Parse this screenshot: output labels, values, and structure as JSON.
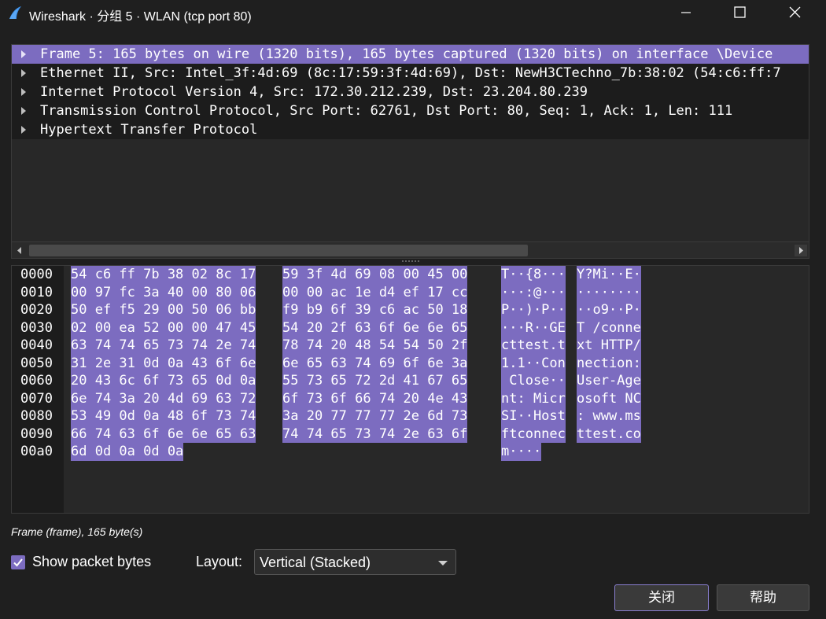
{
  "window": {
    "title": "Wireshark · 分组 5 · WLAN (tcp port 80)"
  },
  "details": {
    "rows": [
      {
        "label": "Frame 5: 165 bytes on wire (1320 bits), 165 bytes captured (1320 bits) on interface \\Device",
        "selected": true
      },
      {
        "label": "Ethernet II, Src: Intel_3f:4d:69 (8c:17:59:3f:4d:69), Dst: NewH3CTechno_7b:38:02 (54:c6:ff:7",
        "selected": false
      },
      {
        "label": "Internet Protocol Version 4, Src: 172.30.212.239, Dst: 23.204.80.239",
        "selected": false
      },
      {
        "label": "Transmission Control Protocol, Src Port: 62761, Dst Port: 80, Seq: 1, Ack: 1, Len: 111",
        "selected": false
      },
      {
        "label": "Hypertext Transfer Protocol",
        "selected": false
      }
    ]
  },
  "bytes": {
    "lines": [
      {
        "offset": "0000",
        "hex1": "54 c6 ff 7b 38 02 8c 17",
        "hex2": "59 3f 4d 69 08 00 45 00",
        "ascii1": "T··{8···",
        "ascii2": "Y?Mi··E·"
      },
      {
        "offset": "0010",
        "hex1": "00 97 fc 3a 40 00 80 06",
        "hex2": "00 00 ac 1e d4 ef 17 cc",
        "ascii1": "···:@···",
        "ascii2": "········"
      },
      {
        "offset": "0020",
        "hex1": "50 ef f5 29 00 50 06 bb",
        "hex2": "f9 b9 6f 39 c6 ac 50 18",
        "ascii1": "P··)·P··",
        "ascii2": "··o9··P·"
      },
      {
        "offset": "0030",
        "hex1": "02 00 ea 52 00 00 47 45",
        "hex2": "54 20 2f 63 6f 6e 6e 65",
        "ascii1": "···R··GE",
        "ascii2": "T /conne"
      },
      {
        "offset": "0040",
        "hex1": "63 74 74 65 73 74 2e 74",
        "hex2": "78 74 20 48 54 54 50 2f",
        "ascii1": "cttest.t",
        "ascii2": "xt HTTP/"
      },
      {
        "offset": "0050",
        "hex1": "31 2e 31 0d 0a 43 6f 6e",
        "hex2": "6e 65 63 74 69 6f 6e 3a",
        "ascii1": "1.1··Con",
        "ascii2": "nection:"
      },
      {
        "offset": "0060",
        "hex1": "20 43 6c 6f 73 65 0d 0a",
        "hex2": "55 73 65 72 2d 41 67 65",
        "ascii1": " Close··",
        "ascii2": "User-Age"
      },
      {
        "offset": "0070",
        "hex1": "6e 74 3a 20 4d 69 63 72",
        "hex2": "6f 73 6f 66 74 20 4e 43",
        "ascii1": "nt: Micr",
        "ascii2": "osoft NC"
      },
      {
        "offset": "0080",
        "hex1": "53 49 0d 0a 48 6f 73 74",
        "hex2": "3a 20 77 77 77 2e 6d 73",
        "ascii1": "SI··Host",
        "ascii2": ": www.ms"
      },
      {
        "offset": "0090",
        "hex1": "66 74 63 6f 6e 6e 65 63",
        "hex2": "74 74 65 73 74 2e 63 6f",
        "ascii1": "ftconnec",
        "ascii2": "ttest.co"
      },
      {
        "offset": "00a0",
        "hex1": "6d 0d 0a 0d 0a",
        "hex2": "",
        "ascii1": "m····",
        "ascii2": ""
      }
    ]
  },
  "status": {
    "text": "Frame (frame), 165 byte(s)"
  },
  "controls": {
    "show_bytes_label": "Show packet bytes",
    "show_bytes_checked": true,
    "layout_label": "Layout:",
    "layout_value": "Vertical (Stacked)",
    "close_label": "关闭",
    "help_label": "帮助"
  },
  "colors": {
    "accent": "#7c6cc0",
    "background": "#1f1f1f"
  }
}
